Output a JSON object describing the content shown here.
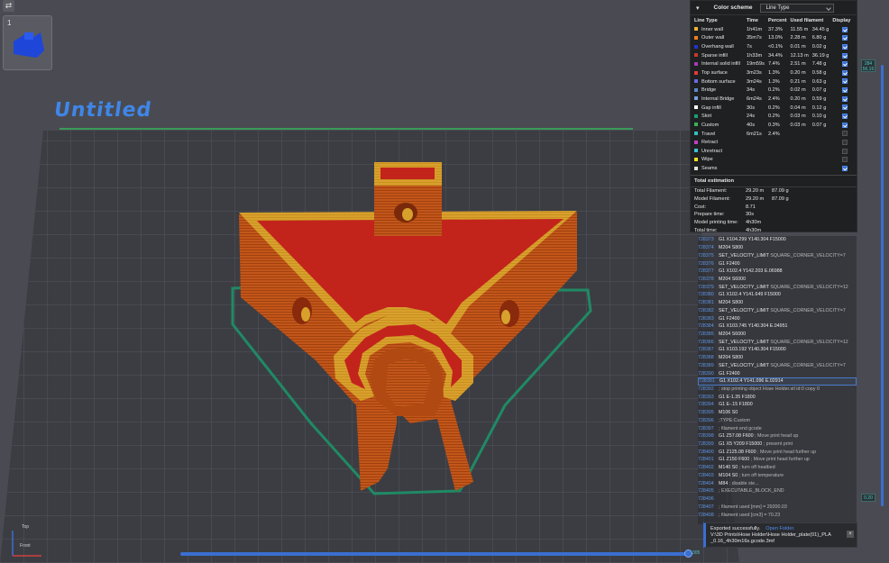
{
  "viewport": {
    "title": "Untitled",
    "plate_number": "1",
    "axes": {
      "top": "Top",
      "front": "Front"
    }
  },
  "panel": {
    "header": {
      "label": "Color scheme",
      "select_value": "Line Type"
    },
    "columns": [
      "Line Type",
      "Time",
      "Percent",
      "Used filament",
      "Display"
    ],
    "rows": [
      {
        "name": "Inner wall",
        "time": "1h41m",
        "pct": "37.3%",
        "len": "11.55 m",
        "g": "34.45 g",
        "color": "#f2b43a",
        "on": true
      },
      {
        "name": "Outer wall",
        "time": "35m7s",
        "pct": "13.0%",
        "len": "2.28 m",
        "g": "6.80 g",
        "color": "#f07e1e",
        "on": true
      },
      {
        "name": "Overhang wall",
        "time": "7s",
        "pct": "<0.1%",
        "len": "0.01 m",
        "g": "0.02 g",
        "color": "#2233cc",
        "on": true
      },
      {
        "name": "Sparse infill",
        "time": "1h33m",
        "pct": "34.4%",
        "len": "12.13 m",
        "g": "36.19 g",
        "color": "#c43a2a",
        "on": true
      },
      {
        "name": "Internal solid infill",
        "time": "19m59s",
        "pct": "7.4%",
        "len": "2.51 m",
        "g": "7.48 g",
        "color": "#a33bb4",
        "on": true
      },
      {
        "name": "Top surface",
        "time": "3m23s",
        "pct": "1.3%",
        "len": "0.20 m",
        "g": "0.58 g",
        "color": "#e23a3a",
        "on": true
      },
      {
        "name": "Bottom surface",
        "time": "3m24s",
        "pct": "1.3%",
        "len": "0.21 m",
        "g": "0.63 g",
        "color": "#6a6ae0",
        "on": true
      },
      {
        "name": "Bridge",
        "time": "34s",
        "pct": "0.2%",
        "len": "0.02 m",
        "g": "0.07 g",
        "color": "#5c88c8",
        "on": true
      },
      {
        "name": "Internal Bridge",
        "time": "6m24s",
        "pct": "2.4%",
        "len": "0.20 m",
        "g": "0.59 g",
        "color": "#7aa0e0",
        "on": true
      },
      {
        "name": "Gap infill",
        "time": "30s",
        "pct": "0.2%",
        "len": "0.04 m",
        "g": "0.12 g",
        "color": "#ffffff",
        "on": true
      },
      {
        "name": "Skirt",
        "time": "24s",
        "pct": "0.2%",
        "len": "0.03 m",
        "g": "0.10 g",
        "color": "#1f9a74",
        "on": true
      },
      {
        "name": "Custom",
        "time": "40s",
        "pct": "0.3%",
        "len": "0.03 m",
        "g": "0.07 g",
        "color": "#3ab15a",
        "on": true
      },
      {
        "name": "Travel",
        "time": "6m21s",
        "pct": "2.4%",
        "len": "",
        "g": "",
        "color": "#2fc0c0",
        "on": false
      },
      {
        "name": "Retract",
        "time": "",
        "pct": "",
        "len": "",
        "g": "",
        "color": "#c040c0",
        "on": false
      },
      {
        "name": "Unretract",
        "time": "",
        "pct": "",
        "len": "",
        "g": "",
        "color": "#40c0d0",
        "on": false
      },
      {
        "name": "Wipe",
        "time": "",
        "pct": "",
        "len": "",
        "g": "",
        "color": "#f0e020",
        "on": false
      },
      {
        "name": "Seams",
        "time": "",
        "pct": "",
        "len": "",
        "g": "",
        "color": "#e0e0e0",
        "on": true
      }
    ],
    "totals": {
      "heading": "Total estimation",
      "rows": [
        {
          "k": "Total Filament:",
          "v1": "29.20 m",
          "v2": "87.09 g"
        },
        {
          "k": "Model Filament:",
          "v1": "29.20 m",
          "v2": "87.09 g"
        },
        {
          "k": "Cost:",
          "v1": "8.71",
          "v2": ""
        },
        {
          "k": "Prepare time:",
          "v1": "30s",
          "v2": ""
        },
        {
          "k": "Model printing time:",
          "v1": "4h30m",
          "v2": ""
        },
        {
          "k": "Total time:",
          "v1": "4h30m",
          "v2": ""
        }
      ]
    }
  },
  "gcode": [
    {
      "n": "728373",
      "c": "G1 X104.299 Y140.304 F15000",
      "m": ""
    },
    {
      "n": "728374",
      "c": "M204 S800",
      "m": ""
    },
    {
      "n": "728375",
      "c": "SET_VELOCITY_LIMIT",
      "m": "SQUARE_CORNER_VELOCITY=7"
    },
    {
      "n": "728376",
      "c": "G1 F2400",
      "m": ""
    },
    {
      "n": "728377",
      "c": "G1 X102.4 Y142.203 E.06988",
      "m": ""
    },
    {
      "n": "728378",
      "c": "M204 S6000",
      "m": ""
    },
    {
      "n": "728379",
      "c": "SET_VELOCITY_LIMIT",
      "m": "SQUARE_CORNER_VELOCITY=12"
    },
    {
      "n": "728380",
      "c": "G1 X102.4 Y141.649 F15000",
      "m": ""
    },
    {
      "n": "728381",
      "c": "M204 S800",
      "m": ""
    },
    {
      "n": "728382",
      "c": "SET_VELOCITY_LIMIT",
      "m": "SQUARE_CORNER_VELOCITY=7"
    },
    {
      "n": "728383",
      "c": "G1 F2400",
      "m": ""
    },
    {
      "n": "728384",
      "c": "G1 X103.745 Y140.304 E.04951",
      "m": ""
    },
    {
      "n": "728385",
      "c": "M204 S6000",
      "m": ""
    },
    {
      "n": "728386",
      "c": "SET_VELOCITY_LIMIT",
      "m": "SQUARE_CORNER_VELOCITY=12"
    },
    {
      "n": "728387",
      "c": "G1 X103.192 Y140.304 F15000",
      "m": ""
    },
    {
      "n": "728388",
      "c": "M204 S800",
      "m": ""
    },
    {
      "n": "728389",
      "c": "SET_VELOCITY_LIMIT",
      "m": "SQUARE_CORNER_VELOCITY=7"
    },
    {
      "n": "728390",
      "c": "G1 F2400",
      "m": ""
    },
    {
      "n": "728391",
      "c": "G1 X102.4 Y141.096 E.02914",
      "m": "",
      "hl": true
    },
    {
      "n": "728392",
      "c": "",
      "m": "; stop printing object Hose Holder.stl id:0 copy 0"
    },
    {
      "n": "728393",
      "c": "G1 E-1.35 F1800",
      "m": ""
    },
    {
      "n": "728394",
      "c": "G1 E-.15 F1800",
      "m": ""
    },
    {
      "n": "728395",
      "c": "M106 S0",
      "m": ""
    },
    {
      "n": "728396",
      "c": "",
      "m": ";TYPE:Custom"
    },
    {
      "n": "728397",
      "c": "",
      "m": "; filament end gcode"
    },
    {
      "n": "728398",
      "c": "G1 Z57.08 F600",
      "m": "; Move print head up"
    },
    {
      "n": "728399",
      "c": "G1 X5 Y209 F15000",
      "m": "; present print"
    },
    {
      "n": "728400",
      "c": "G1 Z125.08 F600",
      "m": "; Move print head further up"
    },
    {
      "n": "728401",
      "c": "G1 Z150 F600",
      "m": "; Move print head further up"
    },
    {
      "n": "728402",
      "c": "M140 S0",
      "m": "; turn off heatbed"
    },
    {
      "n": "728403",
      "c": "M104 S0",
      "m": "; turn off temperature"
    },
    {
      "n": "728404",
      "c": "M84",
      "m": "; disable ste..."
    },
    {
      "n": "728405",
      "c": "",
      "m": "; EXECUTABLE_BLOCK_END"
    },
    {
      "n": "728406",
      "c": "",
      "m": ""
    },
    {
      "n": "728407",
      "c": "",
      "m": "; filament used [mm] = 29200.03"
    },
    {
      "n": "728408",
      "c": "",
      "m": "; filament used [cm3] = 70.23"
    }
  ],
  "toast": {
    "line1": "Exported successfully.",
    "link": "Open Folder.",
    "line2": "V:\\3D Prints\\Hose Holder\\Hose Holder_plate(01)_PLA",
    "line3": "_0.16_4h30m16s.gcode.3mf"
  },
  "sliders": {
    "top_label": "284\n56.16",
    "bottom_label": "0.20",
    "h_label": "305"
  }
}
